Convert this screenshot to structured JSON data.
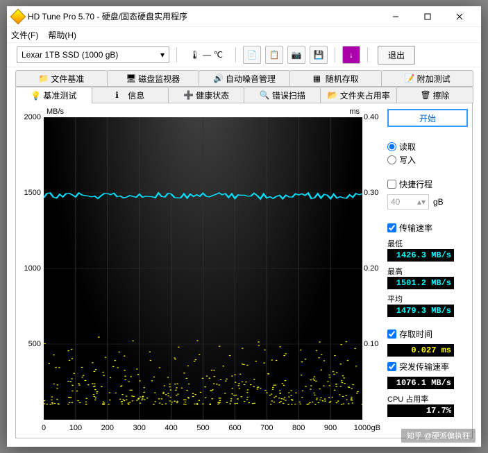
{
  "window": {
    "title": "HD Tune Pro 5.70 - 硬盘/固态硬盘实用程序"
  },
  "menu": {
    "file": "文件(F)",
    "help": "帮助(H)"
  },
  "device": {
    "selected": "Lexar 1TB SSD (1000 gB)"
  },
  "temperature": {
    "text": "— ℃"
  },
  "exit_label": "退出",
  "tabs_top": [
    "文件基准",
    "磁盘监视器",
    "自动噪音管理",
    "随机存取",
    "附加测试"
  ],
  "tabs_bottom": [
    "基准测试",
    "信息",
    "健康状态",
    "错误扫描",
    "文件夹占用率",
    "擦除"
  ],
  "active_tab": "基准测试",
  "chart_data": {
    "type": "line+scatter",
    "title": "",
    "xlabel": "gB",
    "ylabel_left": "MB/s",
    "ylabel_right": "ms",
    "x_range": [
      0,
      1000
    ],
    "y_left_ticks": [
      500,
      1000,
      1500,
      2000
    ],
    "y_right_ticks": [
      0.1,
      0.2,
      0.3,
      0.4
    ],
    "x_ticks": [
      0,
      100,
      200,
      300,
      400,
      500,
      600,
      700,
      800,
      900,
      1000
    ],
    "transfer_series": {
      "name": "传输速率",
      "color": "#00e0ff",
      "approx_y": 1480,
      "range": [
        1426.3,
        1501.2
      ]
    },
    "access_scatter": {
      "name": "存取时间",
      "color": "#ffff00",
      "approx_band_ms": [
        0.01,
        0.12
      ]
    }
  },
  "controls": {
    "start": "开始",
    "mode": {
      "read": "读取",
      "write": "写入",
      "selected": "read"
    },
    "short_stroke": {
      "label": "快捷行程",
      "checked": false,
      "value": "40",
      "unit": "gB"
    },
    "transfer": {
      "label": "传输速率",
      "checked": true,
      "min": {
        "label": "最低",
        "value": "1426.3 MB/s"
      },
      "max": {
        "label": "最高",
        "value": "1501.2 MB/s"
      },
      "avg": {
        "label": "平均",
        "value": "1479.3 MB/s"
      }
    },
    "access": {
      "label": "存取时间",
      "checked": true,
      "value": "0.027 ms"
    },
    "burst": {
      "label": "突发传输速率",
      "checked": true,
      "value": "1076.1 MB/s"
    },
    "cpu": {
      "label": "CPU 占用率",
      "value": "17.7%"
    }
  },
  "watermark": "知乎 @硬派偏执狂"
}
